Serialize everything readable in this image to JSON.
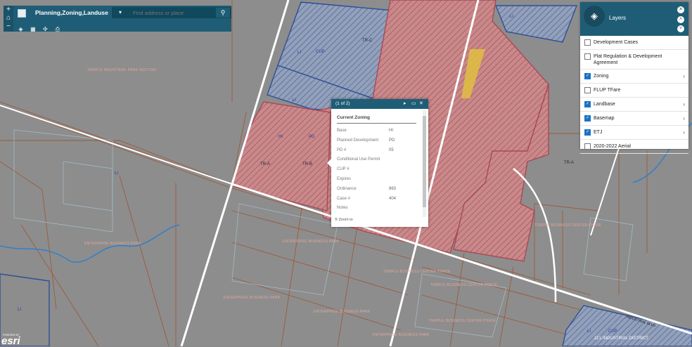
{
  "app": {
    "title": "Planning,Zoning,Landuse",
    "search_placeholder": "Find address or place",
    "zoom_in": "+",
    "home": "⌂",
    "zoom_out": "−"
  },
  "layers_panel": {
    "title": "Layers",
    "items": [
      {
        "label": "Development Cases",
        "checked": false,
        "expandable": false
      },
      {
        "label": "Plat Regulation & Development Agreement",
        "checked": false,
        "expandable": false
      },
      {
        "label": "Zoning",
        "checked": true,
        "expandable": true
      },
      {
        "label": "FLUP TFare",
        "checked": false,
        "expandable": false
      },
      {
        "label": "Landbase",
        "checked": true,
        "expandable": true
      },
      {
        "label": "Basemap",
        "checked": true,
        "expandable": true
      },
      {
        "label": "ETJ",
        "checked": true,
        "expandable": true
      },
      {
        "label": "2020-2022 Aerial",
        "checked": false,
        "expandable": false
      }
    ]
  },
  "popup": {
    "counter": "(1 of 2)",
    "title": "Current Zoning",
    "fields": [
      {
        "key": "Base",
        "value": "HI"
      },
      {
        "key": "Planned Development",
        "value": "PD"
      },
      {
        "key": "PD #",
        "value": "05"
      },
      {
        "key": "Conditional Use Permit",
        "value": ""
      },
      {
        "key": "CUP #",
        "value": ""
      },
      {
        "key": "Expires",
        "value": ""
      },
      {
        "key": "Ordinance",
        "value": "863"
      },
      {
        "key": "Case #",
        "value": "404"
      },
      {
        "key": "Notes",
        "value": ""
      }
    ],
    "zoom_to": "Zoom to"
  },
  "map_labels": {
    "industrial_district": "11'L INDUSTRIAL DISTRICT",
    "industrial_blvd": "INDUSTRIAL BLVD",
    "enterprise_1": "ENTERPRISE BUSINESS PARK",
    "enterprise_2": "ENTERPRISE BUSINESS PARK",
    "enterprise_3": "ENTERPRISE BUSINESS PARK",
    "enterprise_4": "ENTERPRISE BUSINESS PARK",
    "enterprise_5": "ENTERPRISE BUSINESS PARK",
    "temple_center_1": "TEMPLE BUSINESS CENTER PHASE",
    "temple_center_2": "TEMPLE BUSINESS CENTER PHASE",
    "temple_center_3": "TEMPLE BUSINESS CENTER PHASE",
    "temple_industrial": "TEMPLE INDUSTRIAL PARK SECTION",
    "zone_HI": "HI",
    "zone_PD": "PD",
    "zone_LI": "LI",
    "zone_CUP": "CUP",
    "parcel_a": "TR-A",
    "parcel_b": "TR-B",
    "parcel_c": "TR-C"
  },
  "attribution": {
    "powered_by": "POWERED BY",
    "brand": "esri"
  },
  "colors": {
    "toolbar": "#1f5d76",
    "map_bg": "#8a8a8a",
    "zone_red": "#b5545b",
    "zone_blue": "#2e4f96",
    "parcel_line": "#9c5a3c",
    "checkbox_on": "#1a73c8"
  }
}
